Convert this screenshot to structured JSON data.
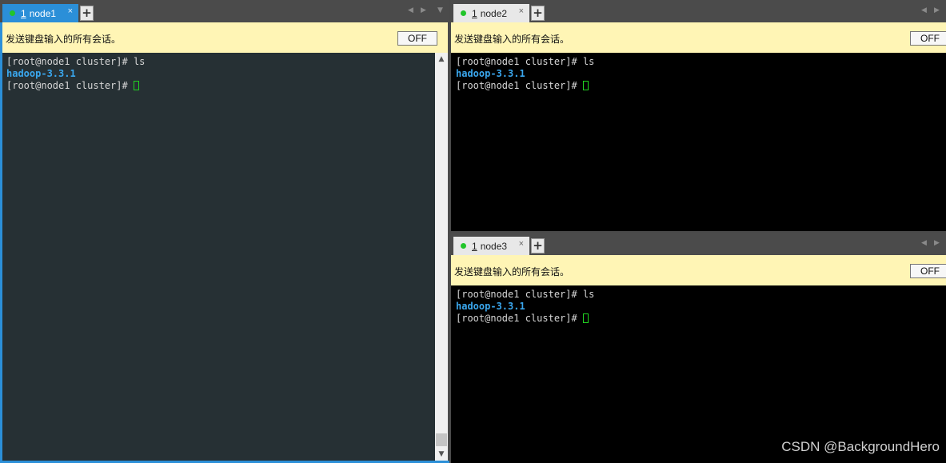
{
  "panes": [
    {
      "tab": {
        "number": "1",
        "label": "node1",
        "close": "×",
        "add": "+",
        "active": true
      },
      "broadcast": {
        "text": "发送键盘输入的所有会话。",
        "button": "OFF"
      },
      "terminal": {
        "lines": [
          {
            "prompt": "[root@node1 cluster]# ",
            "cmd": "ls"
          },
          {
            "output": "hadoop-3.3.1"
          },
          {
            "prompt": "[root@node1 cluster]# ",
            "cursor": true
          }
        ]
      }
    },
    {
      "tab": {
        "number": "1",
        "label": "node2",
        "close": "×",
        "add": "+",
        "active": false
      },
      "broadcast": {
        "text": "发送键盘输入的所有会话。",
        "button": "OFF"
      },
      "terminal": {
        "lines": [
          {
            "prompt": "[root@node1 cluster]# ",
            "cmd": "ls"
          },
          {
            "output": "hadoop-3.3.1"
          },
          {
            "prompt": "[root@node1 cluster]# ",
            "cursor": true
          }
        ]
      }
    },
    {
      "tab": {
        "number": "1",
        "label": "node3",
        "close": "×",
        "add": "+",
        "active": false
      },
      "broadcast": {
        "text": "发送键盘输入的所有会话。",
        "button": "OFF"
      },
      "terminal": {
        "lines": [
          {
            "prompt": "[root@node1 cluster]# ",
            "cmd": "ls"
          },
          {
            "output": "hadoop-3.3.1"
          },
          {
            "prompt": "[root@node1 cluster]# ",
            "cursor": true
          }
        ]
      }
    }
  ],
  "icons": {
    "scroll_left": "◀",
    "scroll_right": "▶",
    "tab_menu": "▼",
    "scroll_up": "▲",
    "scroll_down": "▼"
  },
  "watermark": "CSDN @BackgroundHero",
  "colors": {
    "active_tab": "#2b8fd8",
    "broadcast_bar": "#fff5b5",
    "status_dot": "#22c52a",
    "dir": "#3aa7ee",
    "cursor": "#21d321"
  }
}
